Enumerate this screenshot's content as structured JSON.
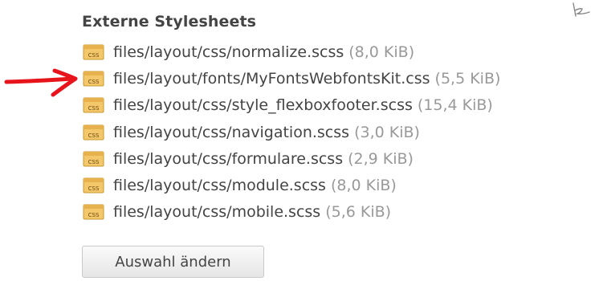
{
  "section": {
    "heading": "Externe Stylesheets"
  },
  "files": [
    {
      "path": "files/layout/css/normalize.scss",
      "size": "(8,0 KiB)",
      "icon": "css-file-icon"
    },
    {
      "path": "files/layout/fonts/MyFontsWebfontsKit.css",
      "size": "(5,5 KiB)",
      "icon": "css-file-icon"
    },
    {
      "path": "files/layout/css/style_flexboxfooter.scss",
      "size": "(15,4 KiB)",
      "icon": "css-file-icon"
    },
    {
      "path": "files/layout/css/navigation.scss",
      "size": "(3,0 KiB)",
      "icon": "css-file-icon"
    },
    {
      "path": "files/layout/css/formulare.scss",
      "size": "(2,9 KiB)",
      "icon": "css-file-icon"
    },
    {
      "path": "files/layout/css/module.scss",
      "size": "(8,0 KiB)",
      "icon": "css-file-icon"
    },
    {
      "path": "files/layout/css/mobile.scss",
      "size": "(5,6 KiB)",
      "icon": "css-file-icon"
    }
  ],
  "icon_label": "CSS",
  "annotation": {
    "arrow_icon": "red-arrow-icon",
    "arrow_color": "#e8141c",
    "points_to_row": 2,
    "corner_mark": "handwritten-mark"
  },
  "button": {
    "label": "Auswahl ändern"
  },
  "colors": {
    "text": "#444444",
    "size_text": "#999999",
    "icon_fill": "#f0c060",
    "icon_border": "#c89a30"
  }
}
